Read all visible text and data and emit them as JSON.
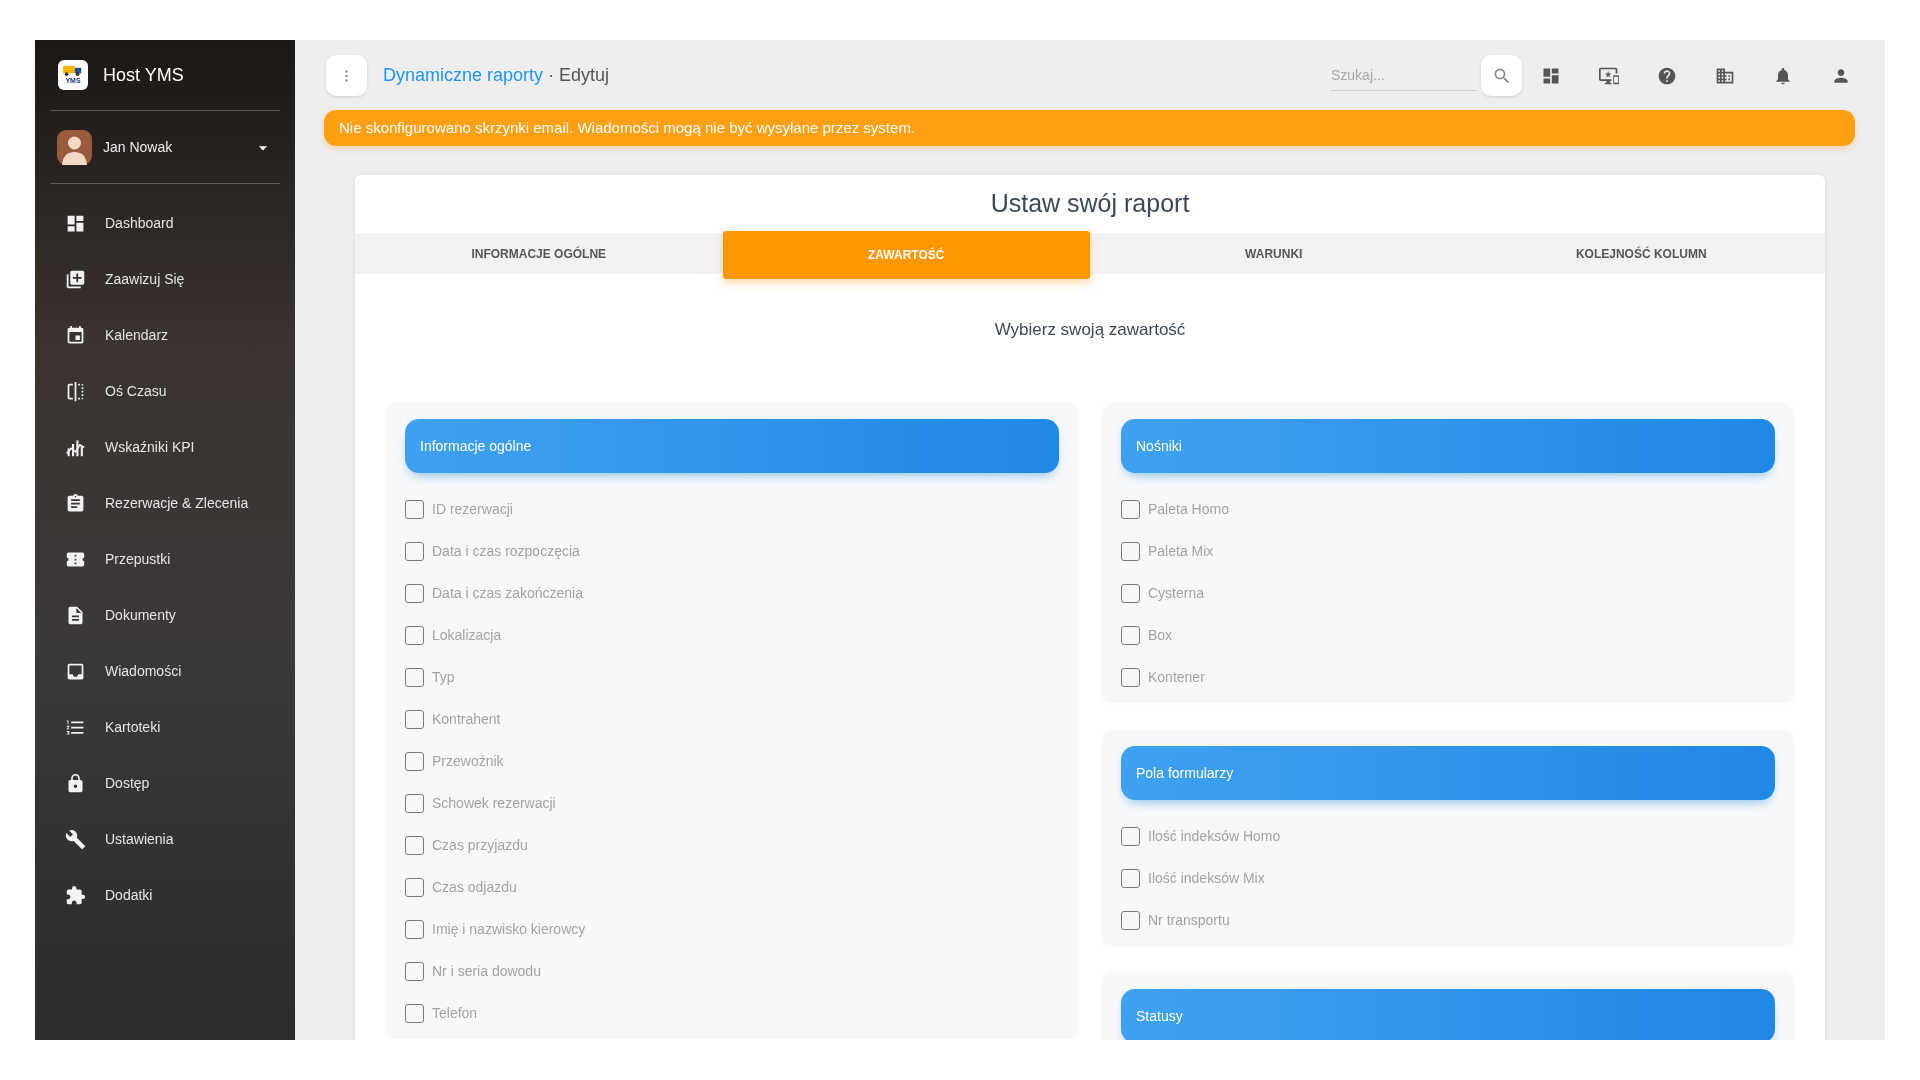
{
  "sidebar": {
    "brand": {
      "logo_text": "YMS",
      "title": "Host YMS"
    },
    "user": {
      "name": "Jan Nowak"
    },
    "items": [
      {
        "label": "Dashboard",
        "selected": false
      },
      {
        "label": "Zaawizuj Się",
        "selected": false
      },
      {
        "label": "Kalendarz",
        "selected": false
      },
      {
        "label": "Oś Czasu",
        "selected": false
      },
      {
        "label": "Wskaźniki KPI",
        "selected": false
      },
      {
        "label": "Rezerwacje & Zlecenia",
        "selected": false
      },
      {
        "label": "Przepustki",
        "selected": false
      },
      {
        "label": "Dokumenty",
        "selected": false
      },
      {
        "label": "Wiadomości",
        "selected": false
      },
      {
        "label": "Kartoteki",
        "selected": false
      },
      {
        "label": "Dostęp",
        "selected": false
      },
      {
        "label": "Ustawienia",
        "selected": false
      },
      {
        "label": "Dodatki",
        "selected": false
      }
    ]
  },
  "topbar": {
    "breadcrumb": [
      {
        "label": "Dynamiczne raporty",
        "kind": "link"
      },
      {
        "label": "Edytuj",
        "kind": "current"
      }
    ],
    "separator": "·",
    "search": {
      "placeholder": "Szukaj..."
    }
  },
  "alert": {
    "text": "Nie skonfigurowano skrzynki email. Wiadomości mogą nie być wysyłane przez system."
  },
  "report": {
    "title": "Ustaw swój raport",
    "tabs": [
      {
        "label": "INFORMACJE OGÓLNE",
        "selected": false
      },
      {
        "label": "ZAWARTOŚĆ",
        "selected": true
      },
      {
        "label": "WARUNKI",
        "selected": false
      },
      {
        "label": "KOLEJNOŚĆ KOLUMN",
        "selected": false
      }
    ],
    "subtitle": "Wybierz swoją zawartość",
    "columns": [
      {
        "groups": [
          {
            "title": "Informacje ogólne",
            "options": [
              {
                "label": "ID rezerwacji",
                "checked": false
              },
              {
                "label": "Data i czas rozpoczęcia",
                "checked": false
              },
              {
                "label": "Data i czas zakończenia",
                "checked": false
              },
              {
                "label": "Lokalizacja",
                "checked": false
              },
              {
                "label": "Typ",
                "checked": false
              },
              {
                "label": "Kontrahent",
                "checked": false
              },
              {
                "label": "Przewoźnik",
                "checked": false
              },
              {
                "label": "Schowek rezerwacji",
                "checked": false
              },
              {
                "label": "Czas przyjazdu",
                "checked": false
              },
              {
                "label": "Czas odjazdu",
                "checked": false
              },
              {
                "label": "Imię i nazwisko kierowcy",
                "checked": false
              },
              {
                "label": "Nr i seria dowodu",
                "checked": false
              },
              {
                "label": "Telefon",
                "checked": false
              }
            ]
          }
        ]
      },
      {
        "groups": [
          {
            "title": "Nośniki",
            "options": [
              {
                "label": "Paleta Homo",
                "checked": false
              },
              {
                "label": "Paleta Mix",
                "checked": false
              },
              {
                "label": "Cysterna",
                "checked": false
              },
              {
                "label": "Box",
                "checked": false
              },
              {
                "label": "Kontener",
                "checked": false
              }
            ]
          },
          {
            "title": "Pola formularzy",
            "options": [
              {
                "label": "Ilość indeksów Homo",
                "checked": false
              },
              {
                "label": "Ilość indeksów Mix",
                "checked": false
              },
              {
                "label": "Nr transportu",
                "checked": false
              }
            ]
          },
          {
            "title": "Statusy"
          }
        ]
      }
    ]
  }
}
